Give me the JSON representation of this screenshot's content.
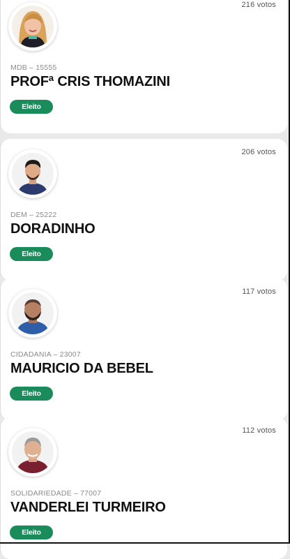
{
  "candidates": [
    {
      "votes": "216 votos",
      "party": "MDB – 15555",
      "name": "PROFª CRIS THOMAZINI",
      "status": "Eleito",
      "photo": "avatar-woman-blonde"
    },
    {
      "votes": "206 votos",
      "party": "DEM – 25222",
      "name": "DORADINHO",
      "status": "Eleito",
      "photo": "avatar-man-dark-hair"
    },
    {
      "votes": "117 votos",
      "party": "CIDADANIA – 23007",
      "name": "MAURICIO DA BEBEL",
      "status": "Eleito",
      "photo": "avatar-man-bald-beard"
    },
    {
      "votes": "112 votos",
      "party": "SOLIDARIEDADE – 77007",
      "name": "VANDERLEI TURMEIRO",
      "status": "Eleito",
      "photo": "avatar-man-grey-hair"
    }
  ],
  "colors": {
    "badge": "#1a8c5c",
    "background": "#e9e9e9"
  }
}
